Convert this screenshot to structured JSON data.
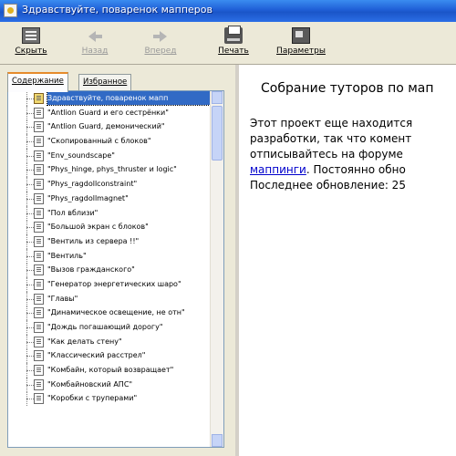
{
  "window": {
    "title": "Здравствуйте, поваренок мапперов"
  },
  "toolbar": {
    "hide": "Скрыть",
    "back": "Назад",
    "forward": "Вперед",
    "print": "Печать",
    "params": "Параметры"
  },
  "tabs": {
    "contents": "Содержание",
    "favorites": "Избранное"
  },
  "tree": {
    "items": [
      "Здравствуйте, поваренок мапп",
      "\"Antlion Guard и его сестрёнки\"",
      "\"Antlion Guard, демонический\"",
      "\"Cкопированный с блоков\"",
      "\"Env_soundscape\"",
      "\"Phys_hinge, phys_thruster и logic\"",
      "\"Phys_ragdollconstraint\"",
      "\"Phys_ragdollmagnet\"",
      "\"Пол вблизи\"",
      "\"Большой экран с блоков\"",
      "\"Вентиль из сервера !!\"",
      "\"Вентиль\"",
      "\"Вызов гражданского\"",
      "\"Генератор энергетических шаро\"",
      "\"Главы\"",
      "\"Динамическое освещение, не отн\"",
      "\"Дождь погашающий дорогу\"",
      "\"Как делать стену\"",
      "\"Классический расстрел\"",
      "\"Комбайн, который возвращает\"",
      "\"Комбайновский АПС\"",
      "\"Коробки с труперами\""
    ]
  },
  "content": {
    "heading": "Собрание туторов по мап",
    "line1": "Этот проект еще находится",
    "line2": "разработки, так что комент",
    "line3": "отписывайтесь на форуме",
    "link": "маппинги",
    "line4_rest": ". Постоянно обно",
    "line5": "Последнее обновление: 25"
  },
  "colors": {
    "title_bar": "#1f5fd6",
    "selection": "#316ac5",
    "link": "#0000cc"
  }
}
